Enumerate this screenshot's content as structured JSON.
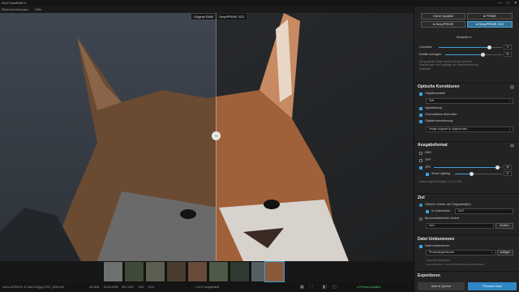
{
  "window": {
    "title": "DxO PureRAW 4",
    "controls": [
      "—",
      "□",
      "✕"
    ]
  },
  "menu": {
    "items": [
      "Bildersammlungen",
      "Hilfe"
    ]
  },
  "viewer": {
    "labels": {
      "original": "Original RAW",
      "processed": "DeepPRIME XD2"
    },
    "handle": "‹›"
  },
  "status": {
    "file": "fuchs-20230910 31 Mai 2024jpg (DSC_3456.nef)",
    "size": "26.0MB",
    "dimensions": "6144×4096",
    "iso": "ISO 1000",
    "shutter": "1/60\"",
    "aperture": "ƒ/5.6",
    "selection": "1 von 9 ausgewählt",
    "preview": "● Preview updated"
  },
  "panel": {
    "quality": {
      "options": [
        "Hohe Qualität",
        "● PRIME",
        "● DeepPRIME",
        "● DeepPRIME XD2"
      ],
      "selected": "DeepPRIME XD2"
    },
    "settings_label": "Einstellen ▾",
    "luminanz_label": "Luminanz",
    "luminanz_value": "72",
    "details_label": "Details erzeugen",
    "details_value": "90",
    "denoise_hint": "Die gewählten Bilder werden mit den aktuellen Einstellungen auf Grundlage der Rauschminderung bearbeitet.",
    "optics": {
      "title": "Optische Korrekturen",
      "lens_softness_label": "Objektivschärfe",
      "lens_softness_value": "Soft",
      "vignetting_label": "Vignettierung",
      "chromatic_label": "Chromatische Aberration",
      "distortion_label": "Objektivverzeichnung",
      "distortion_value": "Image cropped to original ratio"
    },
    "output": {
      "title": "Ausgabeformat",
      "dng_label": "DNG",
      "tiff_label": "TIFF",
      "jpg_label": "JPG",
      "jpg_quality": "95",
      "smart_label": "Smart Lighting",
      "smart_value": "37",
      "note": "Ausdruckgröße erhalten: Ja  |  1.9 MB"
    },
    "target": {
      "title": "Ziel",
      "same_folder_label": "Gleicher Ordner wie Originalbild(er)",
      "subfolder_label": "In Unterordner",
      "subfolder_value": "DxO",
      "custom_label": "Benutzerdefinierter Ordner",
      "custom_value": "DxO",
      "browse_label": "Ändern"
    },
    "rename": {
      "title": "Datei Umbenennen",
      "rename_label": "Datei umbenennen",
      "method_value": "Prozessingmethode",
      "apply_label": "anfügen",
      "preview_label": "Vorschau Dateiname",
      "preview_value": "fuchs-20230910 - von8_PRIMEXD2(DeepPRIMEXD2)"
    },
    "export": {
      "title": "Exportieren",
      "queue_label": "Add to Queue",
      "process_label": "Process Now"
    }
  },
  "colors": {
    "accent": "#3aa0d8",
    "panel": "#232323",
    "background": "#1c1c1c"
  }
}
